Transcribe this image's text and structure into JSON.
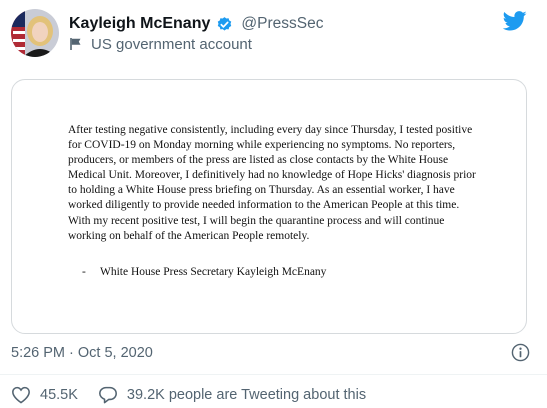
{
  "author": {
    "display_name": "Kayleigh McEnany",
    "handle": "@PressSec",
    "account_label": "US government account",
    "avatar_icon": "profile-photo",
    "verified_icon": "verified-badge-icon",
    "label_icon": "flag-icon"
  },
  "brand": {
    "icon": "twitter-bird-icon",
    "color": "#1d9bf0"
  },
  "statement": {
    "body": "After testing negative consistently, including every day since Thursday, I tested positive for COVID-19 on Monday morning while experiencing no symptoms.  No reporters, producers, or members of the press are listed as close contacts by the White House Medical Unit. Moreover, I definitively had no knowledge of Hope Hicks' diagnosis prior to holding a White House press briefing on Thursday. As an essential worker, I have worked diligently to provide needed information to the American People at this time. With my recent positive test, I will begin the quarantine process and will continue working on behalf of the American People remotely.",
    "signature_dash": "-",
    "signature": "White House Press Secretary Kayleigh McEnany"
  },
  "timestamp": "5:26 PM · Oct 5, 2020",
  "info_icon": "info-icon",
  "actions": {
    "like_icon": "heart-icon",
    "like_count": "45.5K",
    "reply_icon": "speech-bubble-icon",
    "talking_text": "39.2K people are Tweeting about this"
  },
  "colors": {
    "text_primary": "#0f1419",
    "text_secondary": "#536471",
    "verified_blue": "#1d9bf0",
    "border": "#d6dadd"
  }
}
